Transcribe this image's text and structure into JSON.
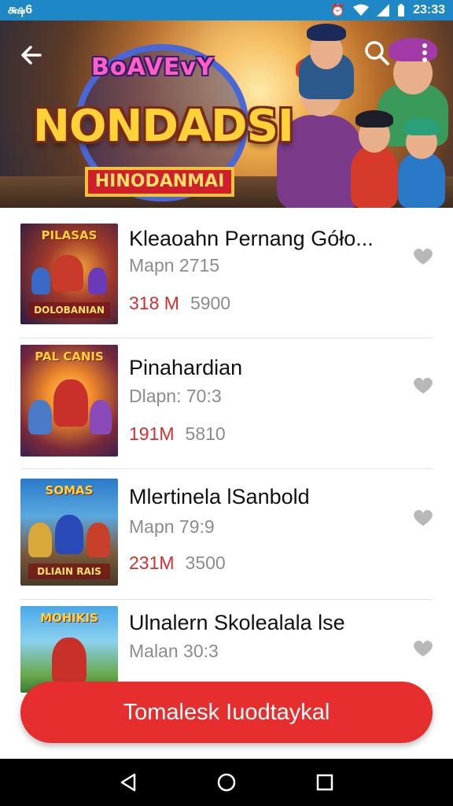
{
  "status_bar": {
    "left_text": "க்ஷ6",
    "time": "23:33",
    "icons": [
      "alarm-icon",
      "wifi-icon",
      "signal-icon",
      "battery-icon"
    ]
  },
  "banner": {
    "logo_top_text": "BoAVEvY",
    "logo_main_text": "NONDADSI",
    "logo_plate_text": "HINODANMAI",
    "back_icon": "arrow-left-icon",
    "search_icon": "search-icon",
    "more_icon": "more-vertical-icon"
  },
  "colors": {
    "status_bar": "#1e88c7",
    "accent_red": "#e72e2e",
    "size_red": "#d32f2f",
    "subtle_gray": "#8c8c8c"
  },
  "items": [
    {
      "title": "Kleaoahn  Pernang Góło...",
      "subtitle": "Mapn  2715",
      "size": "318 M",
      "count": "5900",
      "thumb_title": "PILASAS",
      "thumb_caption": "DOLOBANIAN",
      "fav_icon": "heart-icon"
    },
    {
      "title": "Pinahardian",
      "subtitle": "Dlapn:  70:3",
      "size": "191M",
      "count": "5810",
      "thumb_title": "PAL CANIS",
      "thumb_caption": "",
      "fav_icon": "heart-icon"
    },
    {
      "title": "Mlertinela lSanbold",
      "subtitle": "Mapn  79:9",
      "size": "231M",
      "count": "3500",
      "thumb_title": "SOMAS",
      "thumb_caption": "DLIAIN RAIS",
      "fav_icon": "heart-icon"
    },
    {
      "title": "Ulnalern Skolealala lse",
      "subtitle": "Malan  30:3",
      "size": "",
      "count": "",
      "thumb_title": "MOHIKIS",
      "thumb_caption": "",
      "fav_icon": "heart-icon"
    }
  ],
  "cta": {
    "label": "Tomalesk Iuodtaykal"
  },
  "nav_bar": {
    "back_icon": "triangle-back-icon",
    "home_icon": "circle-home-icon",
    "recents_icon": "square-recents-icon"
  }
}
